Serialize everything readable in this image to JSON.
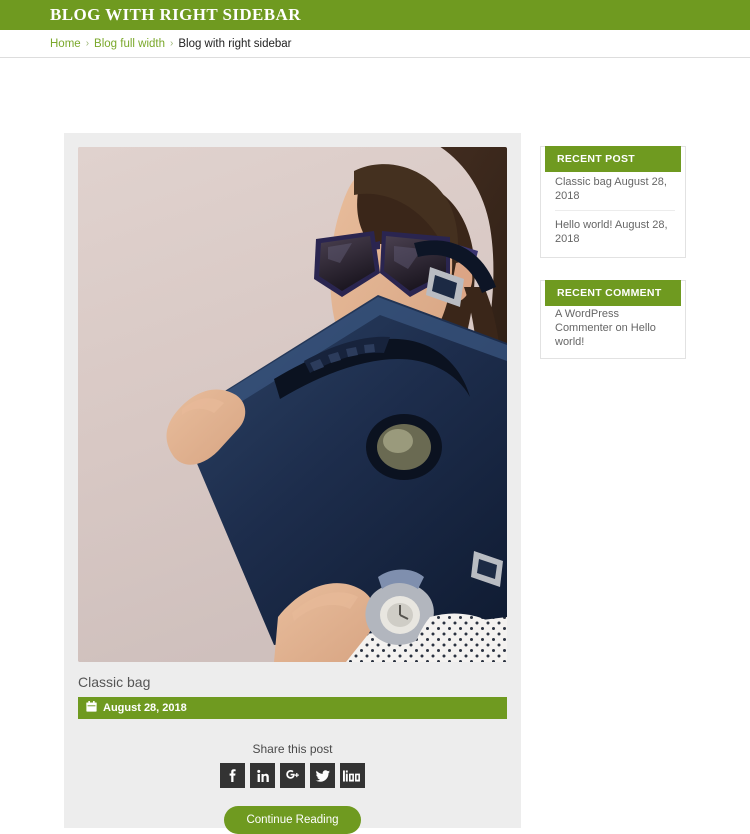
{
  "colors": {
    "brand_green": "#6f9a20",
    "link_green": "#7aa82b",
    "card_bg": "#ededed",
    "social_bg": "#333333"
  },
  "header": {
    "title": "BLOG WITH RIGHT SIDEBAR"
  },
  "breadcrumb": {
    "home": "Home",
    "sep1": "›",
    "parent": "Blog full width",
    "sep2": "›",
    "current": "Blog with right sidebar"
  },
  "post": {
    "title": "Classic bag",
    "date": "August 28, 2018",
    "date_icon": "calendar-icon",
    "image_alt": "Woman wearing sunglasses holding a navy blue handbag",
    "share_label": "Share this post",
    "social": [
      {
        "name": "facebook-icon",
        "label": "f"
      },
      {
        "name": "linkedin-icon",
        "label": "in"
      },
      {
        "name": "googleplus-icon",
        "label": "G+"
      },
      {
        "name": "twitter-icon",
        "label": "t"
      },
      {
        "name": "digg-icon",
        "label": "digg"
      }
    ],
    "continue_label": "Continue Reading"
  },
  "sidebar": {
    "widgets": [
      {
        "title": "RECENT POST",
        "type": "list",
        "items": [
          "Classic bag August 28, 2018",
          "Hello world! August 28, 2018"
        ]
      },
      {
        "title": "RECENT COMMENT",
        "type": "text",
        "text": "A WordPress Commenter on Hello world!"
      }
    ]
  }
}
